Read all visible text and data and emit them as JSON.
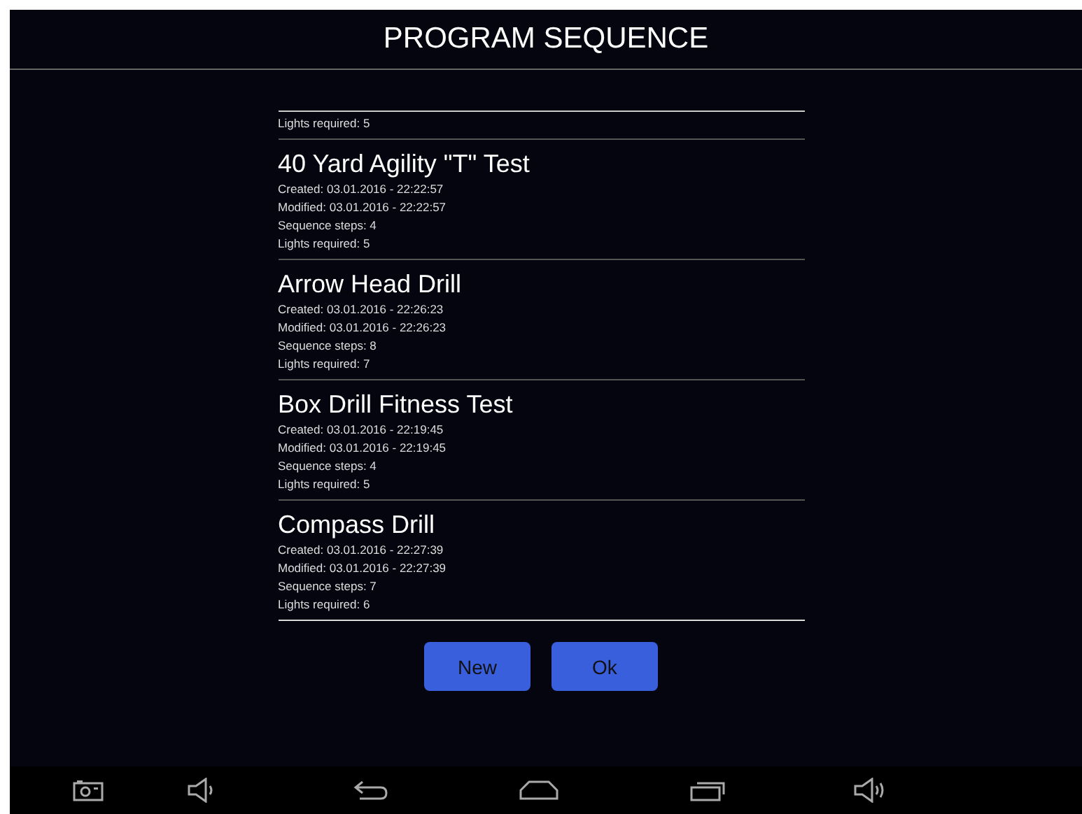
{
  "title": "PROGRAM SEQUENCE",
  "programs": [
    {
      "details": [
        "Lights required: 5"
      ]
    },
    {
      "name": "40 Yard Agility \"T\" Test",
      "details": [
        "Created: 03.01.2016 - 22:22:57",
        "Modified: 03.01.2016 - 22:22:57",
        "Sequence steps: 4",
        "Lights required: 5"
      ]
    },
    {
      "name": "Arrow Head Drill",
      "details": [
        "Created: 03.01.2016 - 22:26:23",
        "Modified: 03.01.2016 - 22:26:23",
        "Sequence steps: 8",
        "Lights required: 7"
      ]
    },
    {
      "name": "Box Drill Fitness Test",
      "details": [
        "Created: 03.01.2016 - 22:19:45",
        "Modified: 03.01.2016 - 22:19:45",
        "Sequence steps: 4",
        "Lights required: 5"
      ]
    },
    {
      "name": "Compass Drill",
      "details": [
        "Created: 03.01.2016 - 22:27:39",
        "Modified: 03.01.2016 - 22:27:39",
        "Sequence steps: 7",
        "Lights required: 6"
      ]
    }
  ],
  "buttons": [
    "New",
    "Ok"
  ]
}
